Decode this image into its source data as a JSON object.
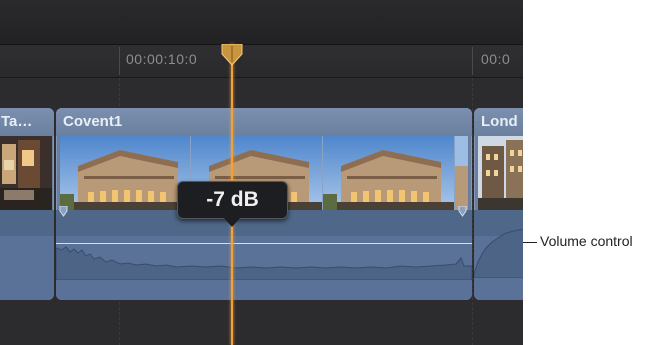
{
  "ruler": {
    "timecode_main": "00:00:10:0",
    "timecode_next": "00:0"
  },
  "clips": {
    "left_partial": "Ta…",
    "main": "Covent1",
    "right_partial": "Lond"
  },
  "volume_readout": "-7 dB",
  "callout": {
    "label": "Volume control"
  },
  "colors": {
    "playhead": "#f1a03b",
    "clip_body": "#6a7fa0",
    "audio_body": "#5a7297",
    "background": "#2b2b2d"
  },
  "icons": {
    "playhead_cap": "playhead-marker-icon",
    "keyframe": "audio-keyframe-icon"
  }
}
